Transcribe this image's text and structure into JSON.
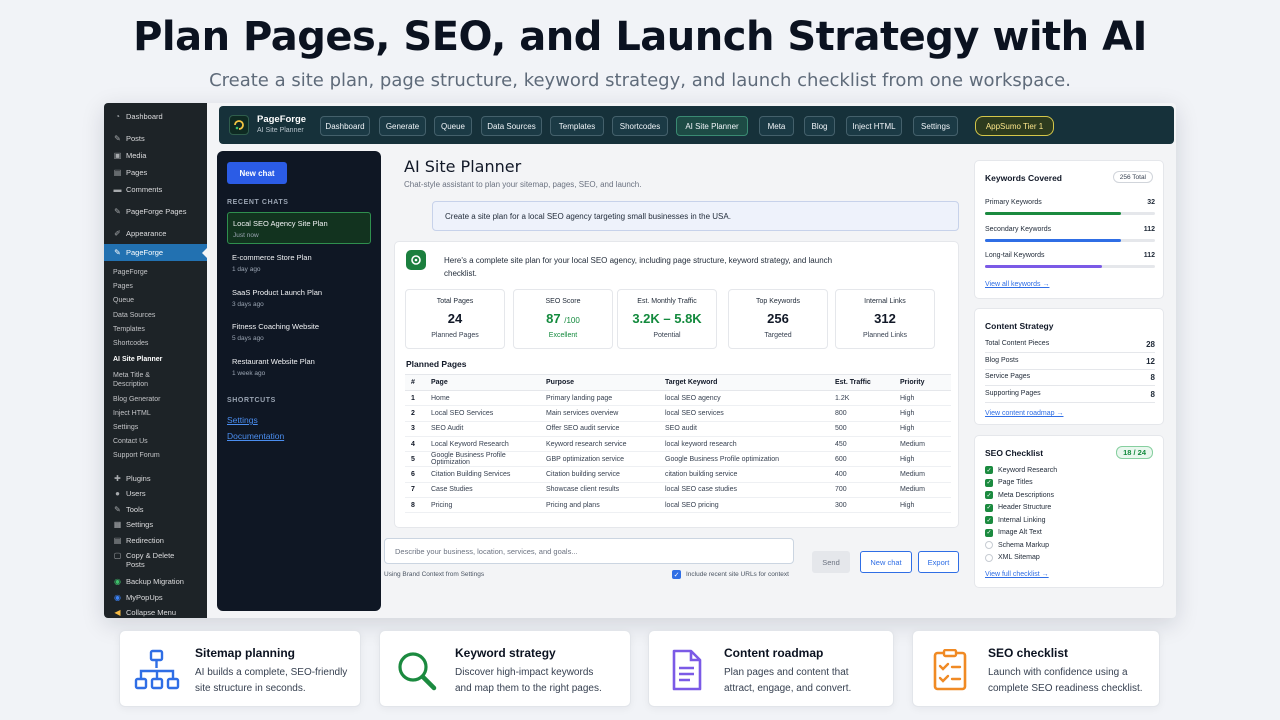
{
  "hero": {
    "title": "Plan Pages, SEO, and Launch Strategy with AI",
    "subtitle": "Create a site plan, page structure, keyword strategy, and launch checklist from one workspace."
  },
  "wp_menu": {
    "items": [
      {
        "label": "Dashboard",
        "icon": "dashboard-icon"
      },
      {
        "label": "Posts",
        "icon": "pin-icon"
      },
      {
        "label": "Media",
        "icon": "media-icon"
      },
      {
        "label": "Pages",
        "icon": "page-icon"
      },
      {
        "label": "Comments",
        "icon": "comment-icon"
      },
      {
        "label": "PageForge Pages",
        "icon": "pin-icon"
      },
      {
        "label": "Appearance",
        "icon": "brush-icon"
      },
      {
        "label": "PageForge",
        "icon": "pin-icon"
      }
    ],
    "submenu": [
      "PageForge",
      "Pages",
      "Queue",
      "Data Sources",
      "Templates",
      "Shortcodes",
      "AI Site Planner",
      "Meta Title & Description",
      "Blog Generator",
      "Inject HTML",
      "Settings",
      "Contact Us",
      "Support Forum"
    ],
    "lower_items": [
      "Plugins",
      "Users",
      "Tools",
      "Settings",
      "Redirection",
      "Copy & Delete Posts",
      "Backup Migration",
      "MyPopUps",
      "Collapse Menu"
    ]
  },
  "topnav": {
    "brand": "PageForge",
    "brand_sub": "AI Site Planner",
    "buttons": [
      "Dashboard",
      "Generate",
      "Queue",
      "Data Sources",
      "Templates",
      "Shortcodes",
      "AI Site Planner",
      "Meta",
      "Blog",
      "Inject HTML",
      "Settings"
    ],
    "tier": "AppSumo Tier 1"
  },
  "chats": {
    "new_chat": "New chat",
    "recent_label": "RECENT CHATS",
    "items": [
      {
        "title": "Local SEO Agency Site Plan",
        "time": "Just now"
      },
      {
        "title": "E-commerce Store Plan",
        "time": "1 day ago"
      },
      {
        "title": "SaaS Product Launch Plan",
        "time": "3 days ago"
      },
      {
        "title": "Fitness Coaching Website",
        "time": "5 days ago"
      },
      {
        "title": "Restaurant Website Plan",
        "time": "1 week ago"
      }
    ],
    "shortcuts_label": "SHORTCUTS",
    "shortcuts": [
      "Settings",
      "Documentation"
    ]
  },
  "main": {
    "title": "AI Site Planner",
    "subtitle": "Chat-style assistant to plan your sitemap, pages, SEO, and launch.",
    "user_message": "Create a site plan for a local SEO agency targeting small businesses in the USA.",
    "ai_message": "Here's a complete site plan for your local SEO agency, including page structure, keyword strategy, and launch checklist.",
    "stats": [
      {
        "label": "Total Pages",
        "value": "24",
        "unit": "",
        "foot": "Planned Pages"
      },
      {
        "label": "SEO Score",
        "value": "87",
        "unit": "/100",
        "foot": "Excellent"
      },
      {
        "label": "Est. Monthly Traffic",
        "value": "3.2K – 5.8K",
        "unit": "",
        "foot": "Potential"
      },
      {
        "label": "Top Keywords",
        "value": "256",
        "unit": "",
        "foot": "Targeted"
      },
      {
        "label": "Internal Links",
        "value": "312",
        "unit": "",
        "foot": "Planned Links"
      }
    ],
    "planned_title": "Planned Pages",
    "table_headers": [
      "#",
      "Page",
      "Purpose",
      "Target Keyword",
      "Est. Traffic",
      "Priority"
    ],
    "rows": [
      [
        "1",
        "Home",
        "Primary landing page",
        "local SEO agency",
        "1.2K",
        "High"
      ],
      [
        "2",
        "Local SEO Services",
        "Main services overview",
        "local SEO services",
        "800",
        "High"
      ],
      [
        "3",
        "SEO Audit",
        "Offer SEO audit service",
        "SEO audit",
        "500",
        "High"
      ],
      [
        "4",
        "Local Keyword Research",
        "Keyword research service",
        "local keyword research",
        "450",
        "Medium"
      ],
      [
        "5",
        "Google Business Profile Optimization",
        "GBP optimization service",
        "Google Business Profile optimization",
        "600",
        "High"
      ],
      [
        "6",
        "Citation Building Services",
        "Citation building service",
        "citation building service",
        "400",
        "Medium"
      ],
      [
        "7",
        "Case Studies",
        "Showcase client results",
        "local SEO case studies",
        "700",
        "Medium"
      ],
      [
        "8",
        "Pricing",
        "Pricing and plans",
        "local SEO pricing",
        "300",
        "High"
      ]
    ],
    "input_placeholder": "Describe your business, location, services, and goals...",
    "brand_context": "Using Brand Context from Settings",
    "include_urls": "Include recent site URLs for context",
    "send": "Send",
    "new_chat": "New chat",
    "export": "Export"
  },
  "keywords": {
    "title": "Keywords Covered",
    "total": "256 Total",
    "rows": [
      {
        "label": "Primary Keywords",
        "value": "32",
        "fill": 0.8,
        "color": "#1b8a3f"
      },
      {
        "label": "Secondary Keywords",
        "value": "112",
        "fill": 0.8,
        "color": "#2f6ee5"
      },
      {
        "label": "Long-tail Keywords",
        "value": "112",
        "fill": 0.69,
        "color": "#7b5ae6"
      }
    ],
    "link": "View all keywords →"
  },
  "content": {
    "title": "Content Strategy",
    "rows": [
      {
        "label": "Total Content Pieces",
        "value": "28"
      },
      {
        "label": "Blog Posts",
        "value": "12"
      },
      {
        "label": "Service Pages",
        "value": "8"
      },
      {
        "label": "Supporting Pages",
        "value": "8"
      }
    ],
    "link": "View content roadmap →"
  },
  "checklist": {
    "title": "SEO Checklist",
    "progress": "18 / 24",
    "items": [
      {
        "label": "Keyword Research",
        "done": true
      },
      {
        "label": "Page Titles",
        "done": true
      },
      {
        "label": "Meta Descriptions",
        "done": true
      },
      {
        "label": "Header Structure",
        "done": true
      },
      {
        "label": "Internal Linking",
        "done": true
      },
      {
        "label": "Image Alt Text",
        "done": true
      },
      {
        "label": "Schema Markup",
        "done": false
      },
      {
        "label": "XML Sitemap",
        "done": false
      }
    ],
    "link": "View full checklist →"
  },
  "features": [
    {
      "title": "Sitemap planning",
      "line1": "AI builds a complete, SEO-friendly",
      "line2": "site structure in seconds.",
      "color": "#2f6ee5"
    },
    {
      "title": "Keyword strategy",
      "line1": "Discover high-impact keywords",
      "line2": "and map them to the right pages.",
      "color": "#1b8a3f"
    },
    {
      "title": "Content roadmap",
      "line1": "Plan pages and content that",
      "line2": "attract, engage, and convert.",
      "color": "#7b5ae6"
    },
    {
      "title": "SEO checklist",
      "line1": "Launch with confidence using a",
      "line2": "complete SEO readiness checklist.",
      "color": "#f08a24"
    }
  ]
}
